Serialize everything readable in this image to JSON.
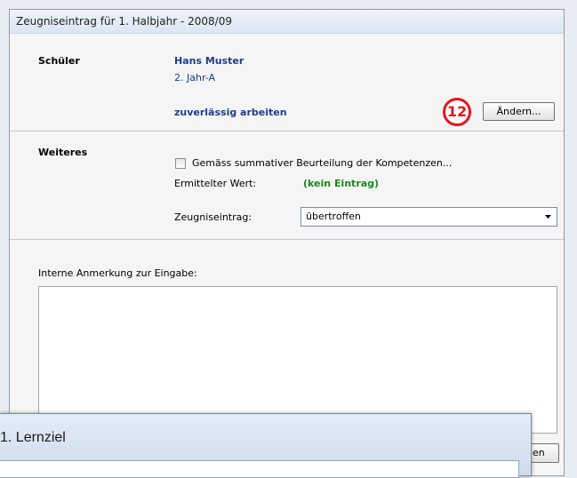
{
  "dialog": {
    "title": "Zeugniseintrag für 1. Halbjahr - 2008/09",
    "student_section": {
      "label": "Schüler",
      "name": "Hans Muster",
      "class": "2. Jahr-A",
      "goal": "zuverlässig arbeiten",
      "badge": "12",
      "change_button": "Ändern..."
    },
    "more_section": {
      "label": "Weiteres",
      "checkbox_label": "Gemäss summativer Beurteilung der Kompetenzen...",
      "computed_label": "Ermittelter Wert:",
      "computed_value": "(kein Eintrag)",
      "entry_label": "Zeugniseintrag:",
      "entry_value": "übertroffen"
    },
    "notes_label": "Interne Anmerkung zur Eingabe:",
    "partial_button": "en"
  },
  "second_window": {
    "title": "1. Lernziel"
  },
  "colors": {
    "accent_blue": "#1d3e8c",
    "green_value": "#1a8a1a",
    "badge_red": "#e8141d"
  }
}
